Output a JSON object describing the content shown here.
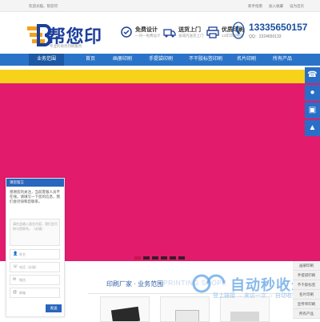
{
  "topbar": {
    "greeting": "欢迎光临，帮您印",
    "links": [
      "新手指南",
      "加入收藏",
      "设为首页"
    ]
  },
  "logo": {
    "text": "帮您印",
    "slogan": "专业的商务印刷服务"
  },
  "features": [
    {
      "icon": "design-icon",
      "title": "免费设计",
      "sub": "一对一免费设计"
    },
    {
      "icon": "delivery-icon",
      "title": "送货上门",
      "sub": "省城内送货上门"
    },
    {
      "icon": "print-icon",
      "title": "优质印刷",
      "sub": "13年印刷经验"
    }
  ],
  "contact": {
    "phone": "13335650157",
    "qq": "QQ：2324650133"
  },
  "nav": {
    "category_label": "业务范围",
    "items": [
      "首页",
      "画册印刷",
      "手提袋印刷",
      "不干胶标签印刷",
      "名片印刷",
      "所有产品"
    ]
  },
  "banner": {
    "colors": {
      "stripe": "#f6d21a",
      "main": "#e31b6c"
    },
    "slide_count": 6,
    "active_slide": 0
  },
  "section": {
    "title": "印刷厂家 · 业务范围",
    "title_en": "PRINTING SCOPE"
  },
  "chat": {
    "header": "请您留言",
    "message": "感谢您的关注，当前客服人员不在线，请填写一下您的信息，我们会尽快和您联系。",
    "textarea_placeholder": "请在此输入留言内容，我们会尽快与您联系。（必填）",
    "fields": [
      {
        "icon": "user-icon",
        "placeholder": "姓名"
      },
      {
        "icon": "phone-icon",
        "placeholder": "电话（必填）"
      },
      {
        "icon": "wechat-icon",
        "placeholder": "微信"
      },
      {
        "icon": "email-icon",
        "placeholder": "邮箱"
      }
    ],
    "send_label": "发送"
  },
  "sidebar": {
    "buttons": [
      {
        "icon": "phone-icon"
      },
      {
        "icon": "qq-icon"
      },
      {
        "icon": "wechat-icon"
      },
      {
        "icon": "top-icon"
      }
    ],
    "list": [
      "画册印刷",
      "手提袋印刷",
      "不干胶标签",
      "名片印刷",
      "宣传单印刷",
      "所有产品"
    ]
  },
  "watermark": {
    "text": "自动秒收录",
    "sub": "登上链接 → 来访一次 → 自动收录"
  }
}
